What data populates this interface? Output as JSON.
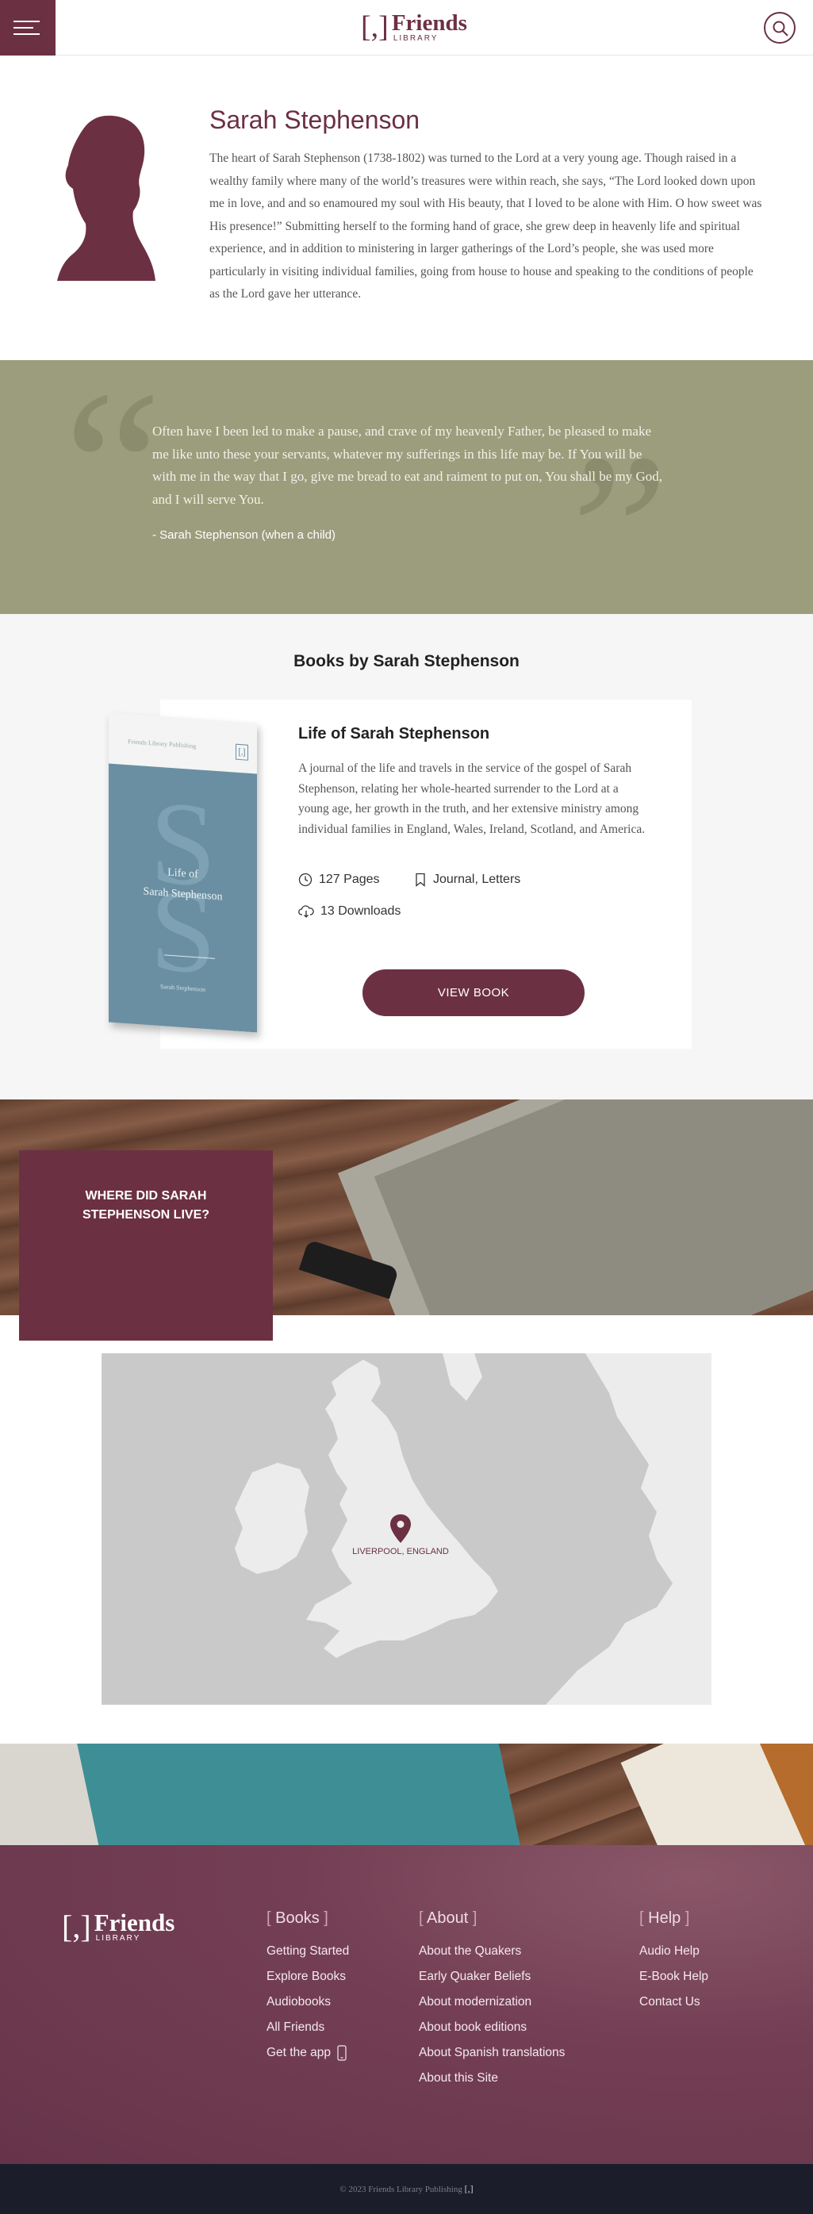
{
  "header": {
    "logo_bracket": "[,]",
    "logo_word": "Friends",
    "logo_sub": "LIBRARY",
    "menu_icon": "hamburger-menu-icon",
    "search_icon": "search-icon",
    "brand_color": "#6c3043"
  },
  "author": {
    "name": "Sarah Stephenson",
    "bio": "The heart of Sarah Stephenson (1738-1802) was turned to the Lord at a very young age. Though raised in a wealthy family where many of the world’s treasures were within reach, she says, “The Lord looked down upon me in love, and and so enamoured my soul with His beauty, that I loved to be alone with Him. O how sweet was His presence!” Submitting herself to the forming hand of grace, she grew deep in heavenly life and spiritual experience, and in addition to ministering in larger gatherings of the Lord’s people, she was used more particularly in visiting individual families, going from house to house and speaking to the conditions of people as the Lord gave her utterance."
  },
  "quote": {
    "open_mark": "“",
    "close_mark": "”",
    "text": "Often have I been led to make a pause, and crave of my heavenly Father, be pleased to make me like unto these your servants, whatever my sufferings in this life may be. If You will be with me in the way that I go, give me bread to eat and raiment to put on, You shall be my God, and I will serve You.",
    "attribution": "- Sarah Stephenson (when a child)",
    "band_color": "#9b9d7c"
  },
  "books": {
    "section_title": "Books by Sarah Stephenson",
    "items": [
      {
        "title": "Life of Sarah Stephenson",
        "description": "A journal of the life and travels in the service of the gospel of Sarah Stephenson, relating her whole-hearted surrender to the Lord at a young age, her growth in the truth, and her extensive ministry among individual families in England, Wales, Ireland, Scotland, and America.",
        "pages": "127 Pages",
        "tags": "Journal, Letters",
        "downloads": "13 Downloads",
        "button": "VIEW BOOK",
        "cover": {
          "publisher": "Friends Library Publishing",
          "bracket": "[,]",
          "initial": "S",
          "title_line1": "Life of",
          "title_line2": "Sarah Stephenson",
          "author": "Sarah Stephenson",
          "color": "#6a8fa2"
        }
      }
    ]
  },
  "residence": {
    "heading": "WHERE DID SARAH STEPHENSON LIVE?",
    "pin_label": "LIVERPOOL, ENGLAND"
  },
  "footer": {
    "logo_bracket": "[,]",
    "logo_word": "Friends",
    "logo_sub": "LIBRARY",
    "columns": [
      {
        "heading": "Books",
        "links": [
          "Getting Started",
          "Explore Books",
          "Audiobooks",
          "All Friends",
          "Get the app"
        ]
      },
      {
        "heading": "About",
        "links": [
          "About the Quakers",
          "Early Quaker Beliefs",
          "About modernization",
          "About book editions",
          "About Spanish translations",
          "About this Site"
        ]
      },
      {
        "heading": "Help",
        "links": [
          "Audio Help",
          "E-Book Help",
          "Contact Us"
        ]
      }
    ],
    "copyright": "© 2023 Friends Library Publishing",
    "copyright_bracket": "[,]"
  }
}
